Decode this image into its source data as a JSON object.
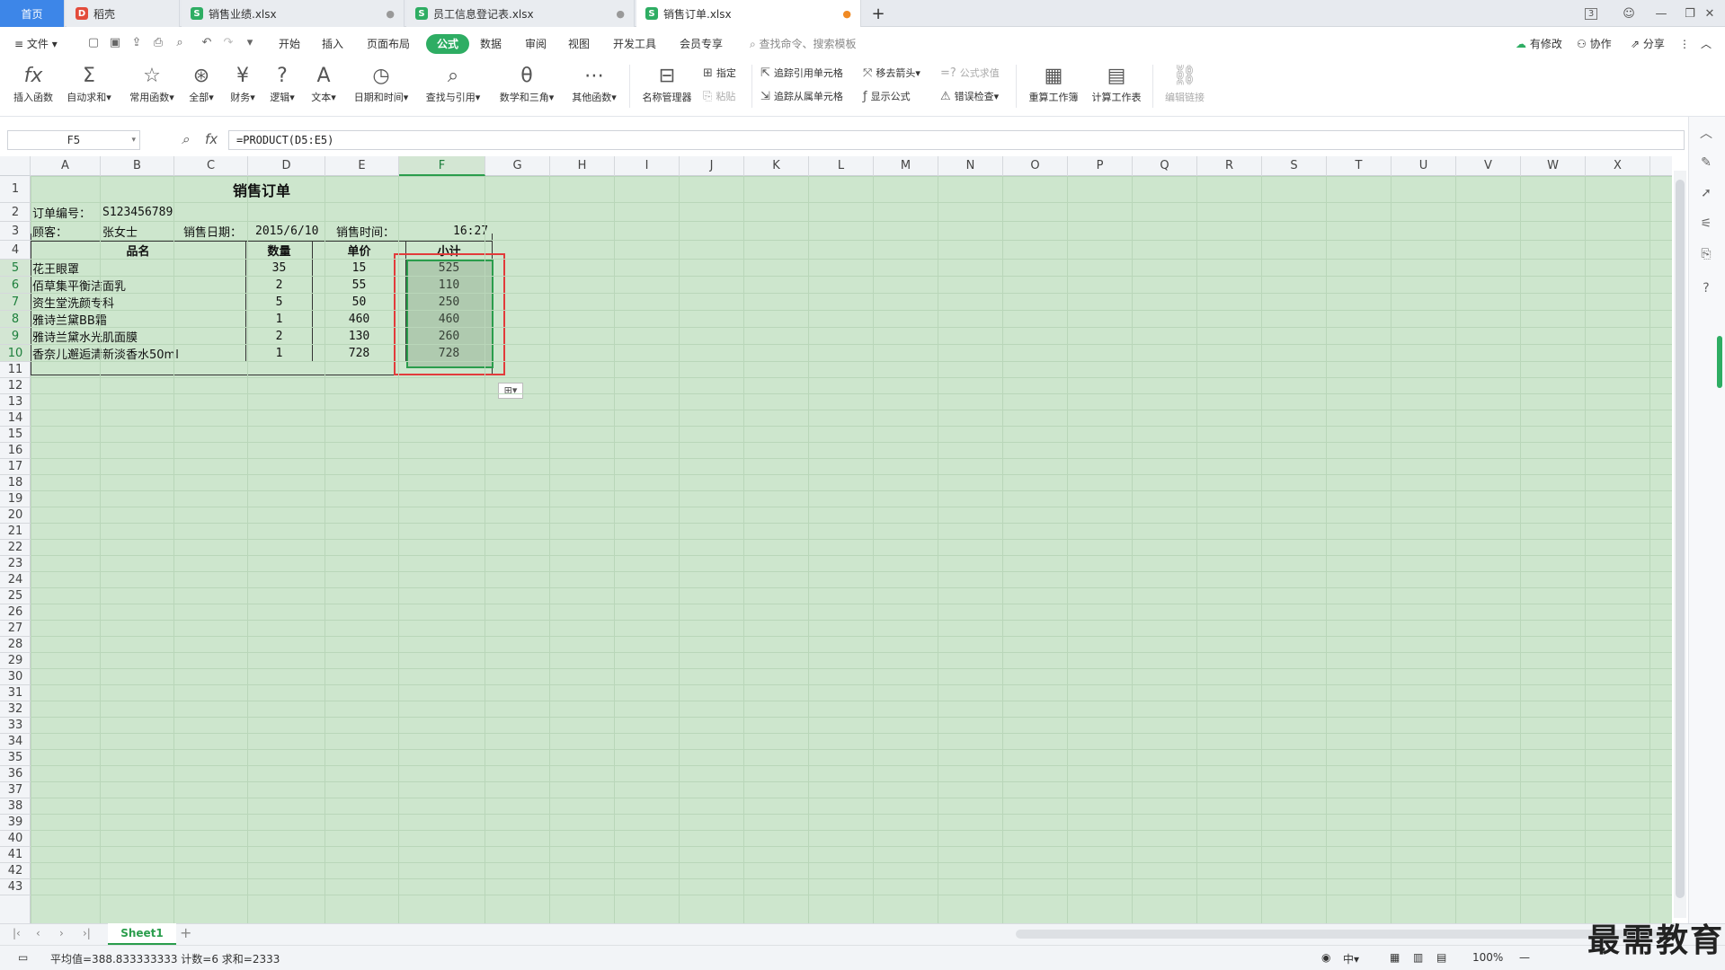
{
  "tabs": [
    {
      "label": "首页"
    },
    {
      "label": "稻壳"
    },
    {
      "label": "销售业绩.xlsx"
    },
    {
      "label": "员工信息登记表.xlsx"
    },
    {
      "label": "销售订单.xlsx"
    }
  ],
  "window": {
    "badge": "3"
  },
  "menu": {
    "file": "文件",
    "items": [
      "开始",
      "插入",
      "页面布局",
      "公式",
      "数据",
      "审阅",
      "视图",
      "开发工具",
      "会员专享"
    ],
    "active": "公式",
    "search_placeholder": "查找命令、搜索模板",
    "right": [
      "有修改",
      "协作",
      "分享"
    ]
  },
  "ribbon": {
    "buttons": [
      "插入函数",
      "自动求和",
      "常用函数",
      "全部",
      "财务",
      "逻辑",
      "文本",
      "日期和时间",
      "查找与引用",
      "数学和三角",
      "其他函数",
      "名称管理器"
    ],
    "small": {
      "specify": "指定",
      "paste": "粘贴",
      "trace_precedents": "追踪引用单元格",
      "trace_dependents": "追踪从属单元格",
      "remove_arrows": "移去箭头",
      "show_formulas": "显示公式",
      "evaluate": "公式求值",
      "error_check": "错误检查"
    },
    "calc": [
      "重算工作簿",
      "计算工作表"
    ],
    "edit_links": "编辑链接"
  },
  "formula_bar": {
    "name_box": "F5",
    "formula": "=PRODUCT(D5:E5)"
  },
  "columns": [
    "A",
    "B",
    "C",
    "D",
    "E",
    "F",
    "G",
    "H",
    "I",
    "J",
    "K",
    "L",
    "M",
    "N",
    "O",
    "P",
    "Q",
    "R",
    "S",
    "T",
    "U",
    "V",
    "W",
    "X"
  ],
  "selected_column": "F",
  "rows": [
    "1",
    "2",
    "3",
    "4",
    "5",
    "6",
    "7",
    "8",
    "9",
    "10",
    "11",
    "12",
    "13",
    "14",
    "15",
    "16",
    "17",
    "18",
    "19",
    "20",
    "21",
    "22",
    "23",
    "24",
    "25",
    "26",
    "27",
    "28",
    "29",
    "30",
    "31",
    "32",
    "33",
    "34",
    "35",
    "36",
    "37",
    "38",
    "39",
    "40",
    "41",
    "42",
    "43"
  ],
  "sheet": {
    "title": "销售订单",
    "order_no_label": "订单编号：",
    "order_no": "S123456789",
    "customer_label": "顾客：",
    "customer": "张女士",
    "date_label": "销售日期：",
    "date": "2015/6/10",
    "time_label": "销售时间：",
    "time": "16:27",
    "headers": [
      "品名",
      "数量",
      "单价",
      "小计"
    ],
    "items": [
      {
        "name": "花王眼罩",
        "qty": "35",
        "price": "15",
        "subtotal": "525"
      },
      {
        "name": "佰草集平衡洁面乳",
        "qty": "2",
        "price": "55",
        "subtotal": "110"
      },
      {
        "name": "资生堂洗颜专科",
        "qty": "5",
        "price": "50",
        "subtotal": "250"
      },
      {
        "name": "雅诗兰黛BB霜",
        "qty": "1",
        "price": "460",
        "subtotal": "460"
      },
      {
        "name": "雅诗兰黛水光肌面膜",
        "qty": "2",
        "price": "130",
        "subtotal": "260"
      },
      {
        "name": "香奈儿邂逅清新淡香水50ml",
        "qty": "1",
        "price": "728",
        "subtotal": "728"
      }
    ]
  },
  "sheet_tabs": [
    "Sheet1"
  ],
  "status": {
    "summary": "平均值=388.833333333  计数=6  求和=2333",
    "zoom": "100%"
  },
  "watermark": "最需教育"
}
